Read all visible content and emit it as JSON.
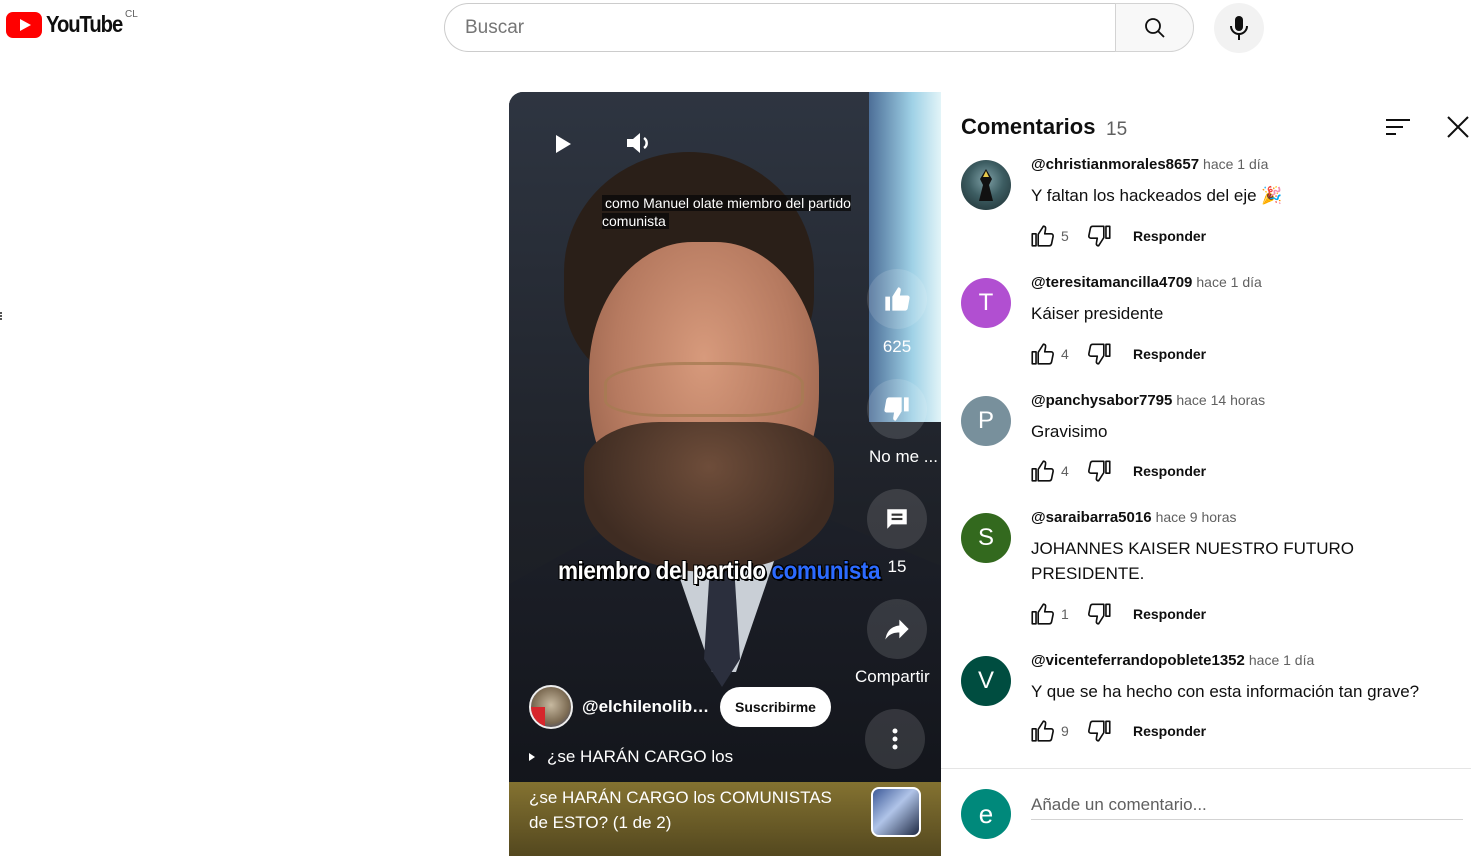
{
  "header": {
    "logo_text": "YouTube",
    "country": "CL",
    "search_placeholder": "Buscar"
  },
  "video": {
    "caption": "como Manuel olate miembro del partido comunista",
    "burned_text_a": "miembro del partido ",
    "burned_text_b": "comunista",
    "like_count": "625",
    "dislike_label": "No me ...",
    "comment_count": "15",
    "share_label": "Compartir",
    "channel_handle": "@elchilenolibe...",
    "subscribe_label": "Suscribirme",
    "description": "¿se HARÁN CARGO los",
    "title": "¿se HARÁN CARGO los COMUNISTAS de ESTO? (1 de 2)"
  },
  "comments_panel": {
    "title": "Comentarios",
    "count": "15",
    "reply_label": "Responder",
    "add_placeholder": "Añade un comentario...",
    "my_initial": "e",
    "comments": [
      {
        "author": "@christianmorales8657",
        "time": "hace 1 día",
        "text": "Y faltan los hackeados del eje 🎉",
        "likes": "5",
        "initial": "",
        "avatar_color": "#2b4a52"
      },
      {
        "author": "@teresitamancilla4709",
        "time": "hace 1 día",
        "text": "Káiser presidente",
        "likes": "4",
        "initial": "T",
        "avatar_color": "#b14fd1"
      },
      {
        "author": "@panchysabor7795",
        "time": "hace 14 horas",
        "text": "Gravisimo",
        "likes": "4",
        "initial": "P",
        "avatar_color": "#78909c"
      },
      {
        "author": "@saraibarra5016",
        "time": "hace 9 horas",
        "text": "JOHANNES KAISER NUESTRO FUTURO PRESIDENTE.",
        "likes": "1",
        "initial": "S",
        "avatar_color": "#33691e"
      },
      {
        "author": "@vicenteferrandopoblete1352",
        "time": "hace 1 día",
        "text": "Y que se ha hecho con esta información tan grave?",
        "likes": "9",
        "initial": "V",
        "avatar_color": "#004d40"
      }
    ]
  }
}
